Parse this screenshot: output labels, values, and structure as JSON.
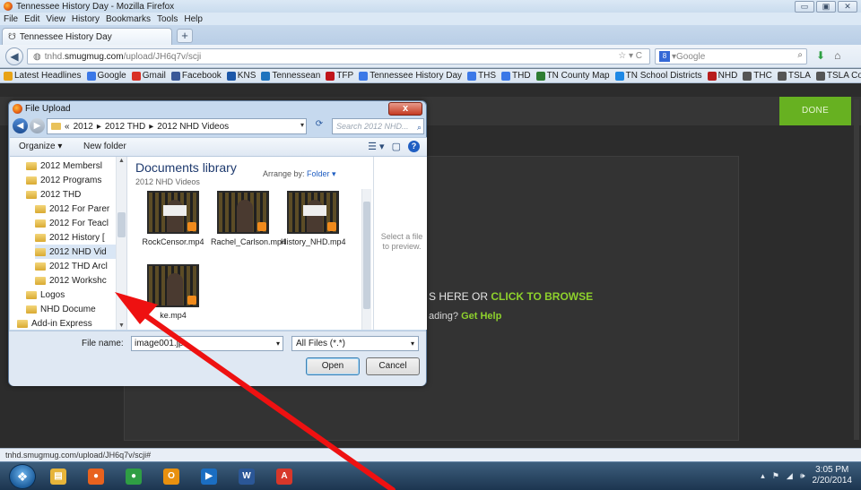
{
  "firefox": {
    "window_title": "Tennessee History Day - Mozilla Firefox",
    "menu": [
      "File",
      "Edit",
      "View",
      "History",
      "Bookmarks",
      "Tools",
      "Help"
    ],
    "tab_title": "Tennessee History Day",
    "new_tab": "+",
    "url_prefix": "tnhd.",
    "url_host": "smugmug.com",
    "url_path": "/upload/JH6q7v/scji",
    "search_placeholder": "Google",
    "search_engine_icon": "google-icon",
    "bookmarks": [
      {
        "label": "Latest Headlines",
        "color": "#e8a317"
      },
      {
        "label": "Google",
        "color": "#3b78e7"
      },
      {
        "label": "Gmail",
        "color": "#d93025"
      },
      {
        "label": "Facebook",
        "color": "#3b5998"
      },
      {
        "label": "KNS",
        "color": "#1c57a8"
      },
      {
        "label": "Tennessean",
        "color": "#1e73be"
      },
      {
        "label": "TFP",
        "color": "#c0151b"
      },
      {
        "label": "Tennessee History Day",
        "color": "#3b78e7"
      },
      {
        "label": "THS",
        "color": "#3b78e7"
      },
      {
        "label": "THD",
        "color": "#3b78e7"
      },
      {
        "label": "TN County Map",
        "color": "#2e7d32"
      },
      {
        "label": "TN School Districts",
        "color": "#1e88e5"
      },
      {
        "label": "NHD",
        "color": "#b71c1c"
      },
      {
        "label": "THC",
        "color": "#555555"
      },
      {
        "label": "TSLA",
        "color": "#555555"
      },
      {
        "label": "TSLA Contacts",
        "color": "#555555"
      }
    ],
    "status_text": "tnhd.smugmug.com/upload/JH6q7v/scji#"
  },
  "page": {
    "done_label": "DONE",
    "drop_text_prefix": "S HERE OR ",
    "drop_text_link": "CLICK TO BROWSE",
    "help_prefix": "ading? ",
    "help_link": "Get Help",
    "accent_color": "#67b121"
  },
  "dialog": {
    "title": "File Upload",
    "close": "x",
    "breadcrumb": [
      "«",
      "2012",
      "▸",
      "2012 THD",
      "▸",
      "2012 NHD Videos"
    ],
    "search_placeholder": "Search 2012 NHD...",
    "organize_label": "Organize ▾",
    "new_folder_label": "New folder",
    "nav_items": [
      {
        "label": "2012 Membersl",
        "indent": 1
      },
      {
        "label": "2012 Programs",
        "indent": 1
      },
      {
        "label": "2012 THD",
        "indent": 1
      },
      {
        "label": "2012 For Parer",
        "indent": 2
      },
      {
        "label": "2012 For Teacl",
        "indent": 2
      },
      {
        "label": "2012 History [",
        "indent": 2
      },
      {
        "label": "2012 NHD Vid",
        "indent": 2
      },
      {
        "label": "2012 THD Arcl",
        "indent": 2
      },
      {
        "label": "2012 Workshc",
        "indent": 2
      },
      {
        "label": "Logos",
        "indent": 1
      },
      {
        "label": "NHD Docume",
        "indent": 1
      },
      {
        "label": "Add-in Express",
        "indent": 0
      }
    ],
    "selected_nav": "2012 NHD Vid",
    "library_title": "Documents library",
    "library_subtitle": "2012 NHD Videos",
    "arrange_label": "Arrange by:",
    "arrange_value": "Folder ▾",
    "files": [
      {
        "name": "RockCensor.mp4",
        "type": "sign"
      },
      {
        "name": "Rachel_Carlson.mp4",
        "type": "person"
      },
      {
        "name": "History_NHD.mp4",
        "type": "sign"
      },
      {
        "name": "ke.mp4",
        "type": "person"
      }
    ],
    "preview_text": "Select a file to preview.",
    "file_name_label": "File name:",
    "file_name_value": "image001.jp",
    "file_type_value": "All Files (*.*)",
    "open_label": "Open",
    "cancel_label": "Cancel"
  },
  "taskbar": {
    "apps": [
      {
        "icon": "file-explorer-icon",
        "color": "#e6b43a",
        "glyph": "▤"
      },
      {
        "icon": "firefox-icon",
        "color": "#e8621e",
        "glyph": "●"
      },
      {
        "icon": "chrome-icon",
        "color": "#2f9e44",
        "glyph": "●"
      },
      {
        "icon": "outlook-icon",
        "color": "#e8900f",
        "glyph": "O"
      },
      {
        "icon": "media-player-icon",
        "color": "#1b6ec2",
        "glyph": "▶"
      },
      {
        "icon": "word-icon",
        "color": "#2b5797",
        "glyph": "W"
      },
      {
        "icon": "acrobat-icon",
        "color": "#d7372a",
        "glyph": "A"
      }
    ],
    "time": "3:05 PM",
    "date": "2/20/2014"
  }
}
